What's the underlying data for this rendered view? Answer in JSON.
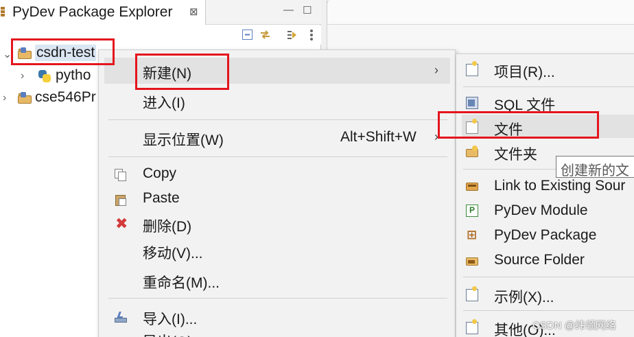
{
  "explorer": {
    "tab_title": "PyDev Package Explorer",
    "tab_close": "⊠",
    "minimize": "—",
    "maximize": "☐",
    "toolbar_icons": [
      "collapse-all-icon",
      "link-with-editor-icon",
      "focus-icon",
      "view-menu-icon"
    ],
    "tree": [
      {
        "label": "csdn-test",
        "expanded": true,
        "icon": "project-icon"
      },
      {
        "label": "pytho",
        "icon": "python-icon",
        "level": 1
      },
      {
        "label": "cse546Pr",
        "expanded": false,
        "icon": "project-icon"
      }
    ]
  },
  "context_menu": {
    "items": [
      {
        "label": "新建(N)",
        "submenu_arrow": "›",
        "highlighted": true
      },
      {
        "label": "进入(I)"
      },
      {
        "label": "显示位置(W)",
        "accelerator": "Alt+Shift+W",
        "submenu_arrow": "›"
      },
      {
        "label": "Copy",
        "icon": "copy-icon"
      },
      {
        "label": "Paste",
        "icon": "paste-icon"
      },
      {
        "label": "删除(D)",
        "icon": "delete-icon"
      },
      {
        "label": "移动(V)..."
      },
      {
        "label": "重命名(M)..."
      },
      {
        "label": "导入(I)...",
        "icon": "import-icon"
      },
      {
        "label": "导出(O)..."
      }
    ]
  },
  "new_submenu": {
    "items": [
      {
        "label": "项目(R)...",
        "icon": "new-project-icon"
      },
      {
        "label": "SQL 文件",
        "icon": "sql-file-icon"
      },
      {
        "label": "文件",
        "icon": "new-file-icon",
        "highlighted": true
      },
      {
        "label": "文件夹",
        "icon": "new-folder-icon"
      },
      {
        "label": "Link to Existing Sour",
        "icon": "link-folder-icon"
      },
      {
        "label": "PyDev Module",
        "icon": "pydev-module-icon"
      },
      {
        "label": "PyDev Package",
        "icon": "pydev-package-icon"
      },
      {
        "label": "Source Folder",
        "icon": "source-folder-icon"
      },
      {
        "label": "示例(X)...",
        "icon": "example-icon"
      },
      {
        "label": "其他(O)...",
        "icon": "other-icon"
      }
    ]
  },
  "tooltip": {
    "text": "创建新的文"
  },
  "annotation": {
    "color": "#e4141d"
  },
  "watermark": {
    "text": "CSDN @纬领网络"
  }
}
